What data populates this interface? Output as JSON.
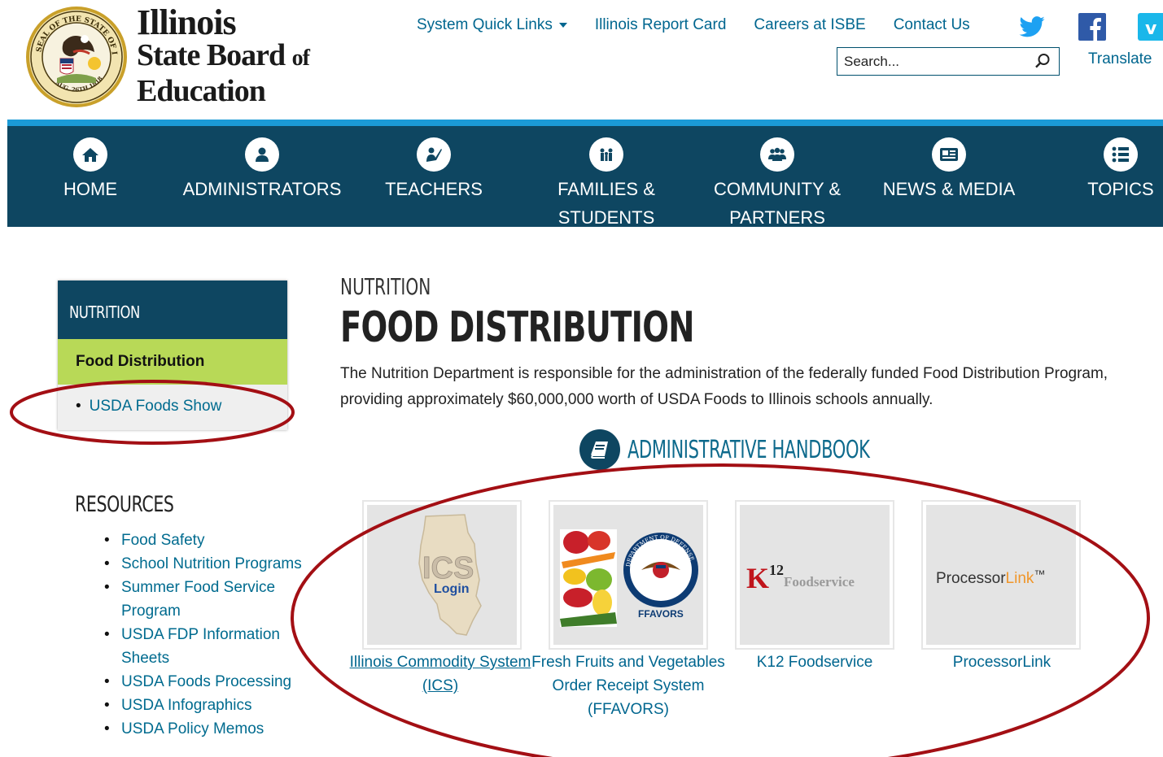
{
  "header": {
    "logo": {
      "line1": "Illinois",
      "line2": "State Board",
      "line2_of": "of",
      "line3": "Education",
      "seal_text": "SEAL OF THE STATE OF ILLINOIS",
      "seal_date": "AUG. 26TH 1818"
    },
    "links": [
      "System Quick Links",
      "Illinois Report Card",
      "Careers at ISBE",
      "Contact Us"
    ],
    "social": [
      "twitter-icon",
      "facebook-icon",
      "vimeo-icon"
    ],
    "search": {
      "placeholder": "Search..."
    },
    "translate": "Translate"
  },
  "nav": {
    "items": [
      {
        "label": "HOME",
        "icon": "home-icon"
      },
      {
        "label": "ADMINISTRATORS",
        "icon": "person-icon"
      },
      {
        "label": "TEACHERS",
        "icon": "teacher-icon"
      },
      {
        "label": "FAMILIES &",
        "label2": "STUDENTS",
        "icon": "family-icon"
      },
      {
        "label": "COMMUNITY &",
        "label2": "PARTNERS",
        "icon": "group-icon"
      },
      {
        "label": "NEWS & MEDIA",
        "icon": "newspaper-icon"
      },
      {
        "label": "TOPICS",
        "icon": "list-icon"
      }
    ]
  },
  "sidebar": {
    "heading": "NUTRITION",
    "active": "Food Distribution",
    "sub_items": [
      "USDA Foods Show"
    ],
    "resources_title": "RESOURCES",
    "resources": [
      "Food Safety",
      "School Nutrition Programs",
      "Summer Food Service Program",
      "USDA FDP Information Sheets",
      "USDA Foods Processing",
      "USDA Infographics",
      "USDA Policy Memos"
    ]
  },
  "main": {
    "section": "NUTRITION",
    "title": "FOOD DISTRIBUTION",
    "intro": "The Nutrition Department is responsible for the administration of the federally funded Food Distribution Program, providing approximately $60,000,000 worth of USDA Foods to Illinois schools annually.",
    "handbook": "ADMINISTRATIVE HANDBOOK",
    "tiles": [
      {
        "caption": "Illinois Commodity System (ICS)",
        "img_text": "ICS",
        "img_sub": "Login"
      },
      {
        "caption": "Fresh Fruits and Vegetables Order Receipt System (FFAVORS)",
        "img_sub": "FFAVORS",
        "seal_text": "DEPARTMENT OF DEFENSE"
      },
      {
        "caption": "K12 Foodservice",
        "img_text": "K",
        "img_sup": "12",
        "img_sub": "Foodservice"
      },
      {
        "caption": "ProcessorLink",
        "img_text": "Processor",
        "img_accent": "Link",
        "img_tm": "™"
      }
    ]
  },
  "colors": {
    "nav_bg": "#0e4661",
    "nav_stripe": "#1b9ad6",
    "link": "#00668f",
    "active_green": "#b8d957",
    "annotation_red": "#a30f14"
  }
}
